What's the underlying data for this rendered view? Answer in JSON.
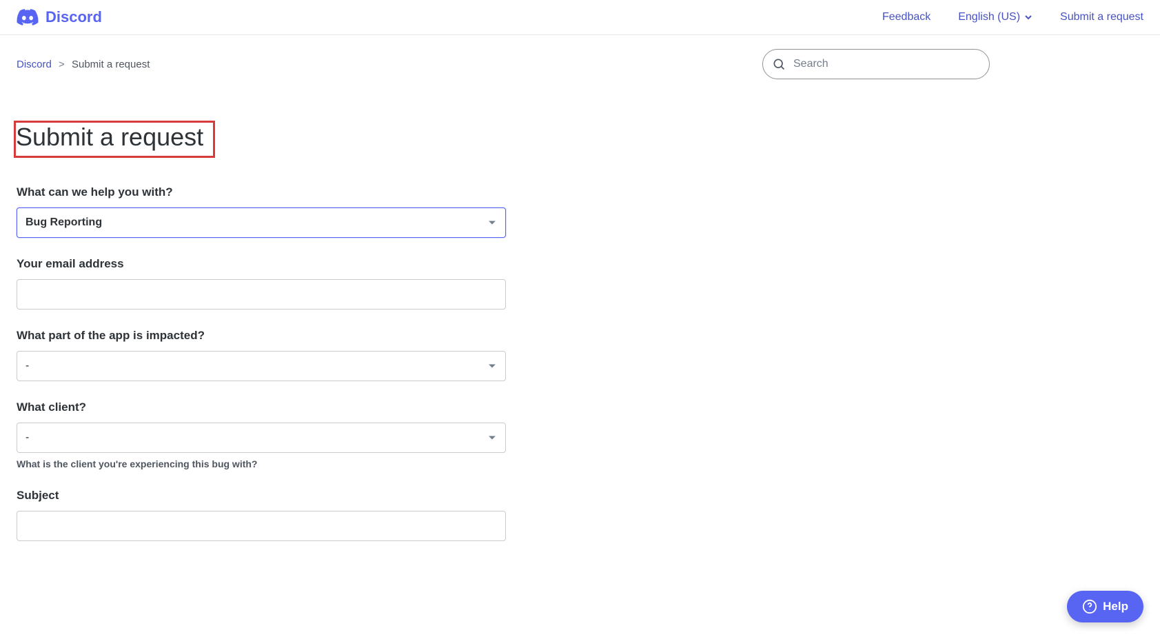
{
  "header": {
    "brand": "Discord",
    "nav": {
      "feedback": "Feedback",
      "language": "English (US)",
      "submit_request": "Submit a request"
    }
  },
  "breadcrumb": {
    "home": "Discord",
    "current": "Submit a request"
  },
  "search": {
    "placeholder": "Search"
  },
  "page": {
    "title": "Submit a request"
  },
  "form": {
    "help_label": "What can we help you with?",
    "help_value": "Bug Reporting",
    "email_label": "Your email address",
    "email_value": "",
    "impact_label": "What part of the app is impacted?",
    "impact_value": "-",
    "client_label": "What client?",
    "client_value": "-",
    "client_hint": "What is the client you're experiencing this bug with?",
    "subject_label": "Subject",
    "subject_value": ""
  },
  "help_widget": {
    "label": "Help"
  }
}
